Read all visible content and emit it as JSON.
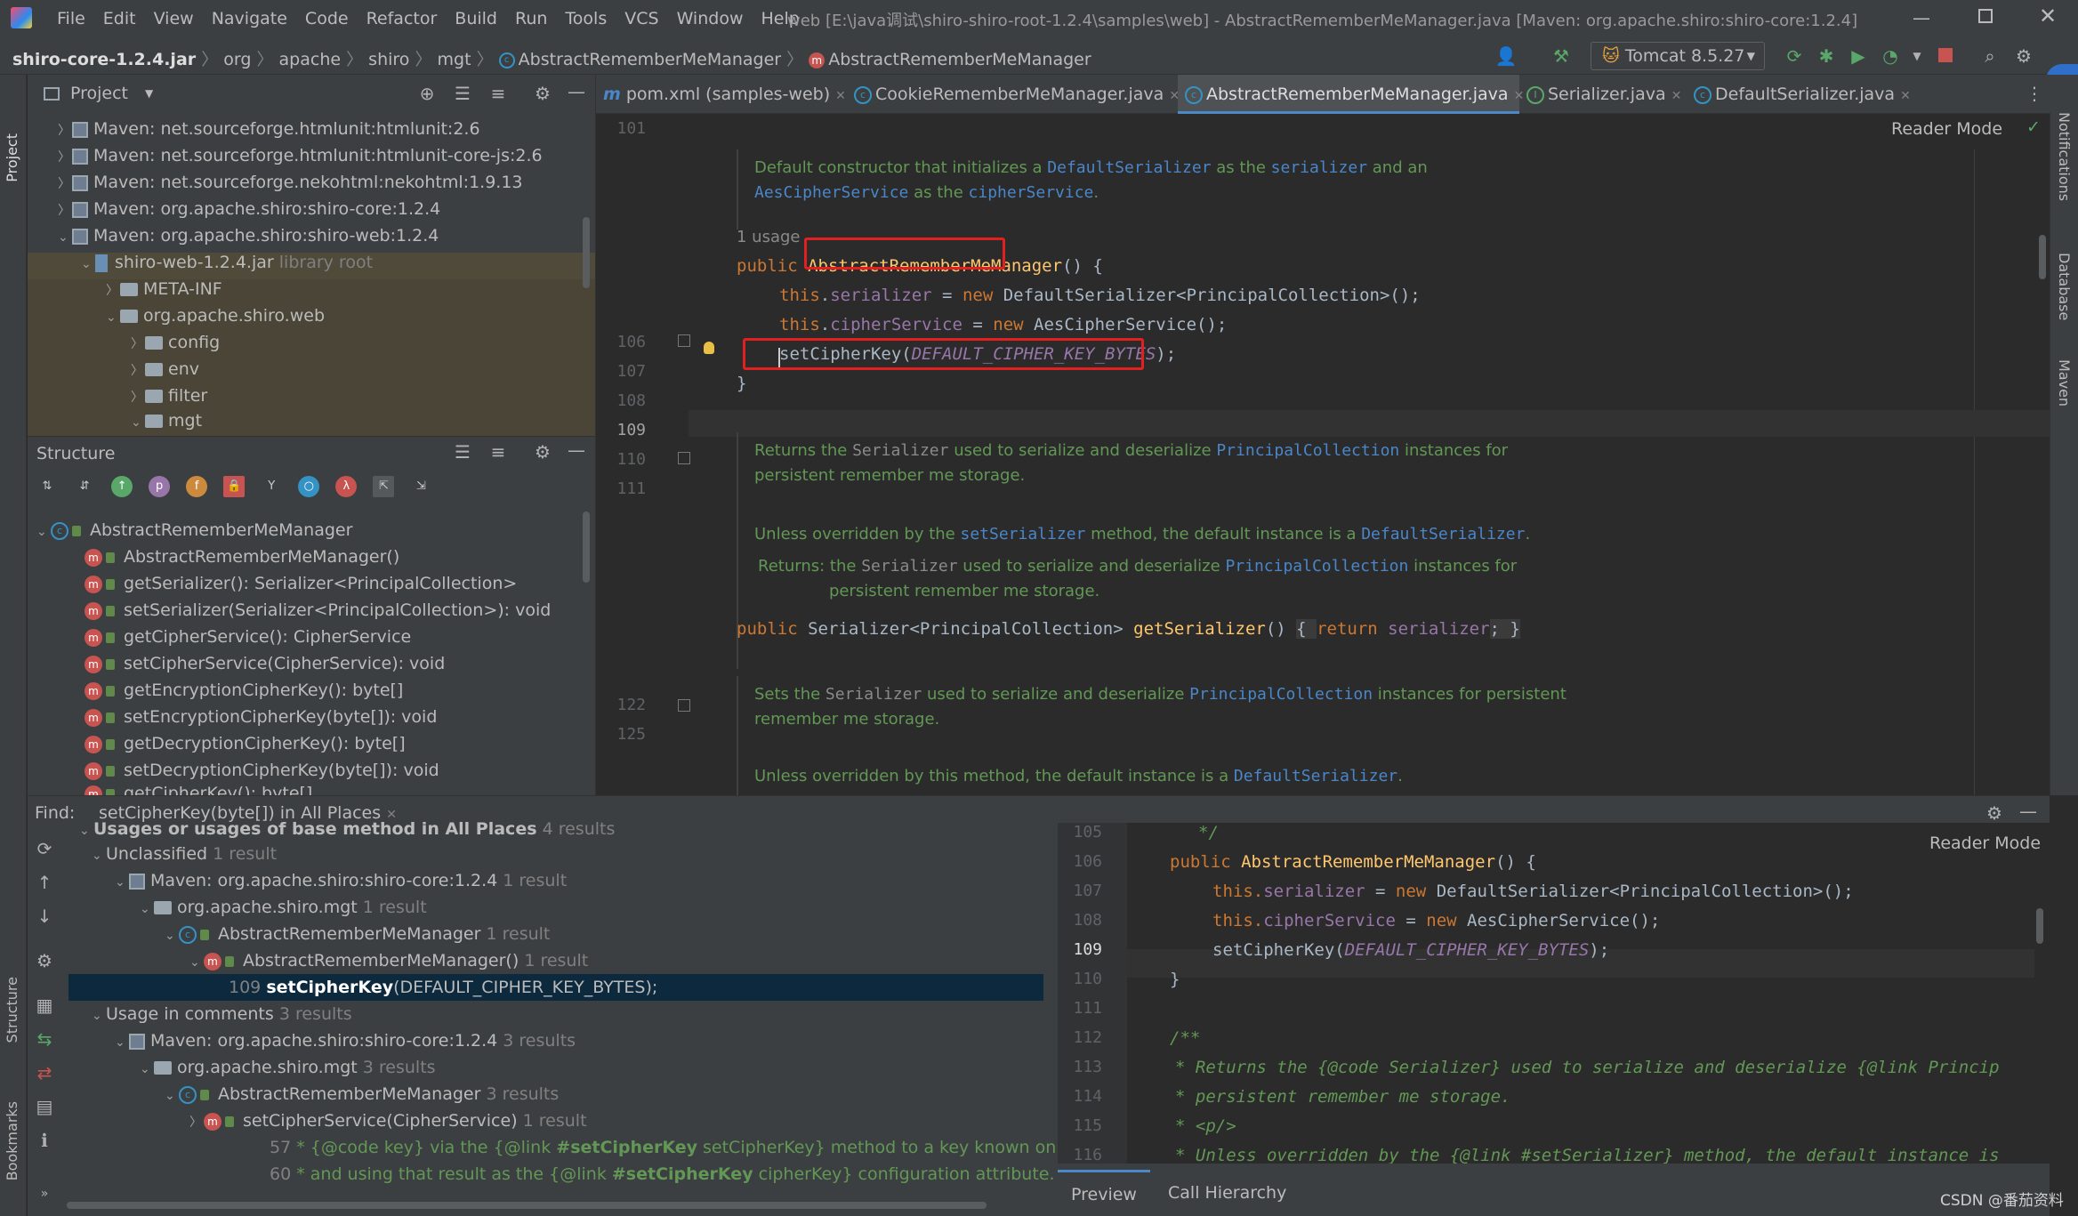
{
  "menubar": {
    "items": [
      "File",
      "Edit",
      "View",
      "Navigate",
      "Code",
      "Refactor",
      "Build",
      "Run",
      "Tools",
      "VCS",
      "Window",
      "Help"
    ],
    "title": "web [E:\\java调试\\shiro-shiro-root-1.2.4\\samples\\web] - AbstractRememberMeManager.java [Maven: org.apache.shiro:shiro-core:1.2.4]"
  },
  "navbar": {
    "crumbs": [
      "shiro-core-1.2.4.jar",
      "org",
      "apache",
      "shiro",
      "mgt",
      "AbstractRememberMeManager",
      "AbstractRememberMeManager"
    ],
    "run_config": "Tomcat 8.5.27"
  },
  "left_strip": {
    "project": "Project",
    "structure": "Structure",
    "bookmarks": "Bookmarks"
  },
  "right_strip": {
    "notifications": "Notifications",
    "database": "Database",
    "maven": "Maven"
  },
  "project": {
    "title": "Project",
    "items": [
      {
        "text": "Maven: net.sourceforge.htmlunit:htmlunit:2.6",
        "extra": ""
      },
      {
        "text": "Maven: net.sourceforge.htmlunit:htmlunit-core-js:2.6",
        "extra": ""
      },
      {
        "text": "Maven: net.sourceforge.nekohtml:nekohtml:1.9.13",
        "extra": ""
      },
      {
        "text": "Maven: org.apache.shiro:shiro-core:1.2.4",
        "extra": ""
      },
      {
        "text": "Maven: org.apache.shiro:shiro-web:1.2.4",
        "extra": ""
      },
      {
        "text": "shiro-web-1.2.4.jar",
        "extra": "library root"
      },
      {
        "text": "META-INF",
        "extra": ""
      },
      {
        "text": "org.apache.shiro.web",
        "extra": ""
      },
      {
        "text": "config",
        "extra": ""
      },
      {
        "text": "env",
        "extra": ""
      },
      {
        "text": "filter",
        "extra": ""
      },
      {
        "text": "mgt",
        "extra": ""
      }
    ]
  },
  "structure": {
    "title": "Structure",
    "class_name": "AbstractRememberMeManager",
    "members": [
      "AbstractRememberMeManager()",
      "getSerializer(): Serializer<PrincipalCollection>",
      "setSerializer(Serializer<PrincipalCollection>): void",
      "getCipherService(): CipherService",
      "setCipherService(CipherService): void",
      "getEncryptionCipherKey(): byte[]",
      "setEncryptionCipherKey(byte[]): void",
      "getDecryptionCipherKey(): byte[]",
      "setDecryptionCipherKey(byte[]): void",
      "getCipherKey(): byte[]"
    ]
  },
  "editor": {
    "tabs": [
      {
        "label": "pom.xml (samples-web)",
        "icon": "m"
      },
      {
        "label": "CookieRememberMeManager.java",
        "icon": "c"
      },
      {
        "label": "AbstractRememberMeManager.java",
        "icon": "c"
      },
      {
        "label": "Serializer.java",
        "icon": "i"
      },
      {
        "label": "DefaultSerializer.java",
        "icon": "c"
      }
    ],
    "reader_mode": "Reader Mode",
    "line_numbers": [
      "101",
      "106",
      "107",
      "108",
      "109",
      "110",
      "111",
      "122",
      "125"
    ],
    "usage_hint": "1 usage",
    "doc1": {
      "a": "Default constructor that initializes a ",
      "b": "DefaultSerializer",
      "c": " as the ",
      "d": "serializer",
      "e": " and an",
      "f": "AesCipherService",
      "g": " as the ",
      "h": "cipherService",
      "i": "."
    },
    "doc2": {
      "a": "Returns the ",
      "b": "Serializer",
      "c": " used to serialize and deserialize ",
      "d": "PrincipalCollection",
      "e": " instances for",
      "f": "persistent remember me storage."
    },
    "doc3": {
      "a": "Unless overridden by the ",
      "b": "setSerializer",
      "c": " method, the default instance is a ",
      "d": "DefaultSerializer",
      "e": "."
    },
    "doc4": {
      "label": "Returns:",
      "a": "the ",
      "b": "Serializer",
      "c": " used to serialize and deserialize ",
      "d": "PrincipalCollection",
      "e": " instances for",
      "f": "persistent remember me storage."
    },
    "doc5": {
      "a": "Sets the ",
      "b": "Serializer",
      "c": " used to serialize and deserialize ",
      "d": "PrincipalCollection",
      "e": " instances for persistent",
      "f": "remember me storage."
    },
    "doc6": {
      "a": "Unless overridden by this method, the default instance is a ",
      "b": "DefaultSerializer",
      "c": "."
    }
  },
  "find": {
    "label": "Find:",
    "tab": "setCipherKey(byte[]) in All Places",
    "rows": [
      {
        "text": "Usages or usages of base method in All Places",
        "count": "4 results"
      },
      {
        "text": "Unclassified",
        "count": "1 result"
      },
      {
        "text": "Maven: org.apache.shiro:shiro-core:1.2.4",
        "count": "1 result"
      },
      {
        "text": "org.apache.shiro.mgt",
        "count": "1 result"
      },
      {
        "text": "AbstractRememberMeManager",
        "count": "1 result"
      },
      {
        "text": "AbstractRememberMeManager()",
        "count": "1 result"
      },
      {
        "text": "Usage in comments",
        "count": "3 results"
      },
      {
        "text": "Maven: org.apache.shiro:shiro-core:1.2.4",
        "count": "3 results"
      },
      {
        "text": "org.apache.shiro.mgt",
        "count": "3 results"
      },
      {
        "text": "AbstractRememberMeManager",
        "count": "3 results"
      },
      {
        "text": "setCipherService(CipherService)",
        "count": "1 result"
      }
    ],
    "selected_line": {
      "num": "109",
      "bold": "setCipherKey",
      "rest": "(DEFAULT_CIPHER_KEY_BYTES);"
    },
    "comment1": {
      "num": "57",
      "a": "* {@code key} via the {@link ",
      "b": "#setCipherKey",
      "c": " setCipherKey} method to a key known only to your applica"
    },
    "comment2": {
      "num": "60",
      "a": "* and using that result as the {@link ",
      "b": "#setCipherKey",
      "c": " cipherKey} configuration attribute."
    },
    "preview_tabs": [
      "Preview",
      "Call Hierarchy"
    ],
    "preview_reader": "Reader Mode",
    "preview_lines": [
      "105",
      "106",
      "107",
      "108",
      "109",
      "110",
      "111",
      "112",
      "113",
      "114",
      "115",
      "116"
    ],
    "preview_code": {
      "l105": "*/",
      "l106a": "public ",
      "l106b": "AbstractRememberMeManager",
      "l106c": "() {",
      "l107a": "this.",
      "l107b": "serializer",
      "l107c": " = ",
      "l107d": "new ",
      "l107e": "DefaultSerializer<PrincipalCollection>();",
      "l108a": "this.",
      "l108b": "cipherService",
      "l108c": " = ",
      "l108d": "new ",
      "l108e": "AesCipherService();",
      "l109a": "setCipherKey(",
      "l109b": "DEFAULT_CIPHER_KEY_BYTES",
      "l109c": ");",
      "l110": "}",
      "l112": "/**",
      "l113": "* Returns the {@code Serializer} used to serialize and deserialize {@link Princip",
      "l114": "* persistent remember me storage.",
      "l115": "* <p/>",
      "l116": "* Unless overridden by the {@link #setSerializer} method, the default instance is"
    }
  },
  "code": {
    "l106a": "public ",
    "l106b": "AbstractRememberMeManager",
    "l106c": "() {",
    "l107a": "this",
    "l107b": ".",
    "l107c": "serializer",
    "l107d": " = ",
    "l107e": "new ",
    "l107f": "DefaultSerializer<PrincipalCollection>();",
    "l108a": "this",
    "l108b": ".",
    "l108c": "cipherService",
    "l108d": " = ",
    "l108e": "new ",
    "l108f": "AesCipherService();",
    "l109a": "setCipherKey(",
    "l109b": "DEFAULT_CIPHER_KEY_BYTES",
    "l109c": ");",
    "l110": "}",
    "l122a": "public ",
    "l122b": "Serializer<PrincipalCollection> ",
    "l122c": "getSerializer",
    "l122d": "() ",
    "l122e": "{ ",
    "l122f": "return ",
    "l122g": "serializer",
    "l122h": "; }"
  },
  "watermark": "CSDN @番茄资料"
}
